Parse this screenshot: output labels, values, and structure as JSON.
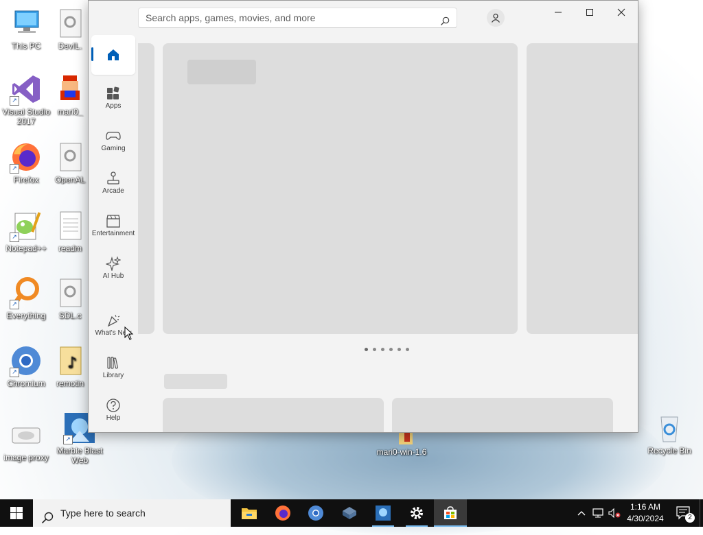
{
  "desktop": {
    "icons": [
      {
        "label": "This PC"
      },
      {
        "label": "DevIL."
      },
      {
        "label": "Visual Studio 2017"
      },
      {
        "label": "mari0_"
      },
      {
        "label": "Firefox"
      },
      {
        "label": "OpenAL"
      },
      {
        "label": "Notepad++"
      },
      {
        "label": "readm"
      },
      {
        "label": "Everything"
      },
      {
        "label": "SDL.c"
      },
      {
        "label": "Chromium"
      },
      {
        "label": "remotin"
      },
      {
        "label": "image proxy"
      },
      {
        "label": "Marble Blast Web"
      },
      {
        "label": "mari0-win-1.6"
      },
      {
        "label": "Recycle Bin"
      }
    ]
  },
  "store": {
    "search_placeholder": "Search apps, games, movies, and more",
    "nav": [
      {
        "label": "Home",
        "icon": "home-icon"
      },
      {
        "label": "Apps",
        "icon": "apps-icon"
      },
      {
        "label": "Gaming",
        "icon": "gamepad-icon"
      },
      {
        "label": "Arcade",
        "icon": "joystick-icon"
      },
      {
        "label": "Entertainment",
        "icon": "clapperboard-icon"
      },
      {
        "label": "AI Hub",
        "icon": "sparkle-icon"
      },
      {
        "label": "What's New",
        "icon": "party-icon"
      },
      {
        "label": "Library",
        "icon": "library-icon"
      },
      {
        "label": "Help",
        "icon": "help-icon"
      }
    ],
    "carousel_page_count": 6,
    "accent": "#005fb8",
    "placeholder_color": "#dddddd"
  },
  "taskbar": {
    "search_placeholder": "Type here to search",
    "apps": [
      "file-explorer",
      "firefox",
      "chromium",
      "virtualbox",
      "marble-blast",
      "settings",
      "microsoft-store"
    ],
    "time": "1:16 AM",
    "date": "4/30/2024",
    "notification_count": "2"
  }
}
